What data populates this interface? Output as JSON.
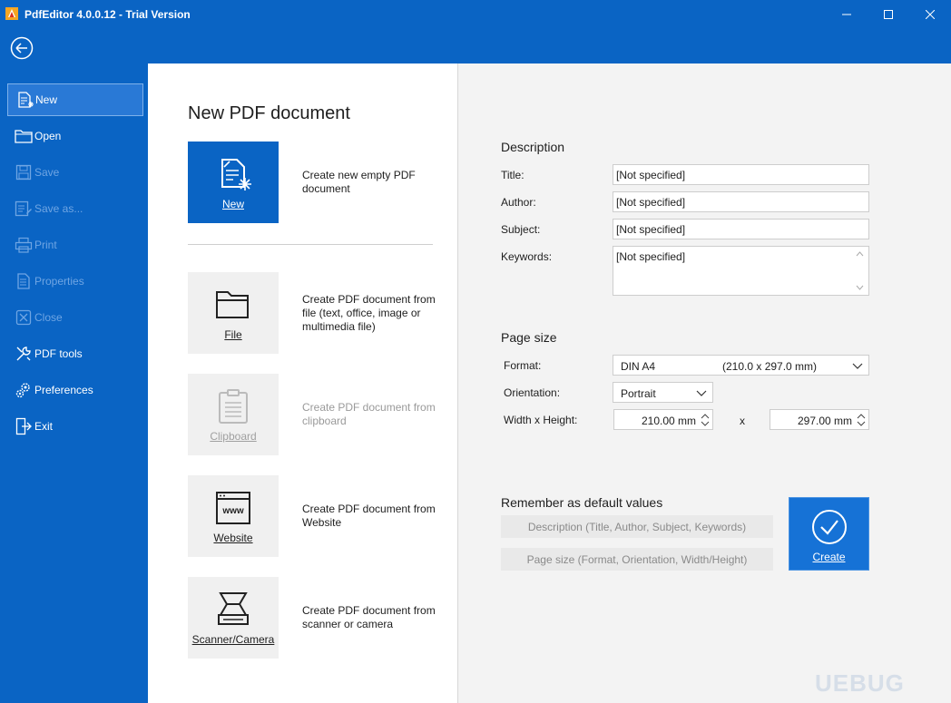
{
  "window": {
    "title": "PdfEditor 4.0.0.12 - Trial Version"
  },
  "sidebar": {
    "items": [
      {
        "label": "New",
        "icon": "new-document-icon",
        "state": "active"
      },
      {
        "label": "Open",
        "icon": "folder-icon",
        "state": "enabled"
      },
      {
        "label": "Save",
        "icon": "save-icon",
        "state": "disabled"
      },
      {
        "label": "Save as...",
        "icon": "save-as-icon",
        "state": "disabled"
      },
      {
        "label": "Print",
        "icon": "printer-icon",
        "state": "disabled"
      },
      {
        "label": "Properties",
        "icon": "properties-icon",
        "state": "disabled"
      },
      {
        "label": "Close",
        "icon": "close-doc-icon",
        "state": "disabled"
      },
      {
        "label": "PDF tools",
        "icon": "tools-icon",
        "state": "enabled"
      },
      {
        "label": "Preferences",
        "icon": "gears-icon",
        "state": "enabled"
      },
      {
        "label": "Exit",
        "icon": "exit-icon",
        "state": "enabled"
      }
    ]
  },
  "main": {
    "title": "New PDF document",
    "tiles": [
      {
        "label": "New",
        "description": "Create new empty PDF document",
        "state": "primary"
      },
      {
        "label": "File",
        "description": "Create PDF document from file (text, office, image or multimedia file)",
        "state": "enabled"
      },
      {
        "label": "Clipboard",
        "description": "Create PDF document from clipboard",
        "state": "disabled"
      },
      {
        "label": "Website",
        "description": "Create PDF document from Website",
        "state": "enabled"
      },
      {
        "label": "Scanner/Camera",
        "description": "Create PDF document from scanner or camera",
        "state": "enabled"
      }
    ]
  },
  "description": {
    "heading": "Description",
    "title_label": "Title:",
    "title_value": "[Not specified]",
    "author_label": "Author:",
    "author_value": "[Not specified]",
    "subject_label": "Subject:",
    "subject_value": "[Not specified]",
    "keywords_label": "Keywords:",
    "keywords_value": "[Not specified]"
  },
  "page_size": {
    "heading": "Page size",
    "format_label": "Format:",
    "format_value": "DIN A4",
    "format_dims": "(210.0 x 297.0 mm)",
    "orientation_label": "Orientation:",
    "orientation_value": "Portrait",
    "wh_label": "Width x Height:",
    "width_value": "210.00 mm",
    "x_sep": "x",
    "height_value": "297.00 mm"
  },
  "defaults": {
    "heading": "Remember as default values",
    "desc_button": "Description (Title, Author, Subject, Keywords)",
    "size_button": "Page size (Format, Orientation, Width/Height)"
  },
  "create_button": {
    "label": "Create"
  },
  "watermark": "UEBUG",
  "colors": {
    "accent": "#0a64c4",
    "background": "#f3f3f3"
  }
}
